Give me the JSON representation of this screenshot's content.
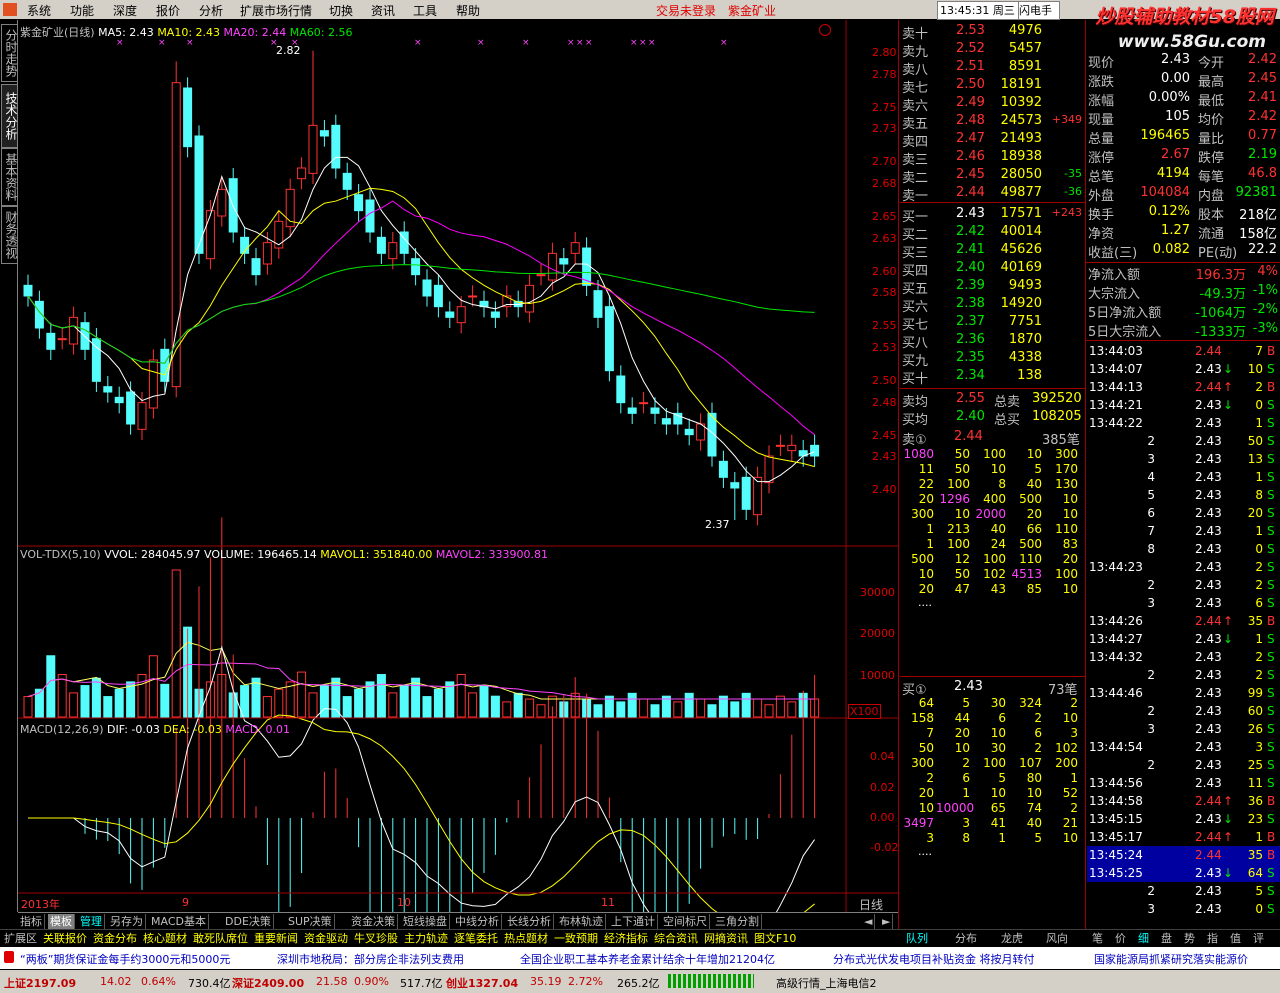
{
  "menubar": {
    "items": [
      "系统",
      "功能",
      "深度",
      "报价",
      "分析",
      "扩展市场行情",
      "切换",
      "资讯",
      "工具",
      "帮助"
    ],
    "status_text": "交易未登录",
    "stock_name": "紫金矿业",
    "clock": "13:45:31 周三",
    "flash": "闪电手",
    "watermark": "炒股辅助教材58股网",
    "watermark2": "www.58Gu.com"
  },
  "left_tabs": [
    "分时走势",
    "技术分析",
    "基本资料",
    "财务透视"
  ],
  "kline": {
    "title": "紫金矿业(日线)",
    "ma5": "MA5: 2.43",
    "ma10": "MA10: 2.43",
    "ma20": "MA20: 2.44",
    "ma60": "MA60: 2.56",
    "high_label": "2.82",
    "low_label": "2.37",
    "y_ticks": [
      "2.80",
      "2.78",
      "2.75",
      "2.73",
      "2.70",
      "2.68",
      "2.65",
      "2.63",
      "2.60",
      "2.58",
      "2.55",
      "2.53",
      "2.50",
      "2.48",
      "2.45",
      "2.43",
      "2.40"
    ],
    "x_labels": [
      "2013年",
      "9",
      "10",
      "11"
    ],
    "period": "日线"
  },
  "vol": {
    "title": "VOL-TDX(5,10)",
    "vvol": "VVOL: 284045.97",
    "volume": "VOLUME: 196465.14",
    "mavol1": "MAVOL1: 351840.00",
    "mavol2": "MAVOL2: 333900.81",
    "y_ticks": [
      "30000",
      "20000",
      "10000"
    ],
    "unit": "X100"
  },
  "macd": {
    "title": "MACD(12,26,9)",
    "dif": "DIF: -0.03",
    "dea": "DEA: -0.03",
    "macd": "MACD: 0.01",
    "y_ticks": [
      "0.04",
      "0.02",
      "0.00",
      "-0.02"
    ]
  },
  "orderbook": {
    "sells": [
      {
        "label": "卖十",
        "price": "2.53",
        "vol": "4976",
        "chg": ""
      },
      {
        "label": "卖九",
        "price": "2.52",
        "vol": "5457",
        "chg": ""
      },
      {
        "label": "卖八",
        "price": "2.51",
        "vol": "8591",
        "chg": ""
      },
      {
        "label": "卖七",
        "price": "2.50",
        "vol": "18191",
        "chg": ""
      },
      {
        "label": "卖六",
        "price": "2.49",
        "vol": "10392",
        "chg": ""
      },
      {
        "label": "卖五",
        "price": "2.48",
        "vol": "24573",
        "chg": "+349"
      },
      {
        "label": "卖四",
        "price": "2.47",
        "vol": "21493",
        "chg": ""
      },
      {
        "label": "卖三",
        "price": "2.46",
        "vol": "18938",
        "chg": ""
      },
      {
        "label": "卖二",
        "price": "2.45",
        "vol": "28050",
        "chg": "-35"
      },
      {
        "label": "卖一",
        "price": "2.44",
        "vol": "49877",
        "chg": "-36"
      }
    ],
    "buys": [
      {
        "label": "买一",
        "price": "2.43",
        "vol": "17571",
        "chg": "+243"
      },
      {
        "label": "买二",
        "price": "2.42",
        "vol": "40014",
        "chg": ""
      },
      {
        "label": "买三",
        "price": "2.41",
        "vol": "45626",
        "chg": ""
      },
      {
        "label": "买四",
        "price": "2.40",
        "vol": "40169",
        "chg": ""
      },
      {
        "label": "买五",
        "price": "2.39",
        "vol": "9493",
        "chg": ""
      },
      {
        "label": "买六",
        "price": "2.38",
        "vol": "14920",
        "chg": ""
      },
      {
        "label": "买七",
        "price": "2.37",
        "vol": "7751",
        "chg": ""
      },
      {
        "label": "买八",
        "price": "2.36",
        "vol": "1870",
        "chg": ""
      },
      {
        "label": "买九",
        "price": "2.35",
        "vol": "4338",
        "chg": ""
      },
      {
        "label": "买十",
        "price": "2.34",
        "vol": "138",
        "chg": ""
      }
    ],
    "avg_sell_label": "卖均",
    "avg_sell": "2.55",
    "total_sell_label": "总卖",
    "total_sell": "392520",
    "avg_buy_label": "买均",
    "avg_buy": "2.40",
    "total_buy_label": "总买",
    "total_buy": "108205",
    "sell1_queue_label": "卖①",
    "sell1_queue_price": "2.44",
    "sell1_queue_count": "385笔",
    "sell1_queue": [
      [
        "1080",
        "50",
        "100",
        "10",
        "300"
      ],
      [
        "11",
        "50",
        "10",
        "5",
        "170"
      ],
      [
        "22",
        "100",
        "8",
        "40",
        "130"
      ],
      [
        "20",
        "1296",
        "400",
        "500",
        "10"
      ],
      [
        "300",
        "10",
        "2000",
        "20",
        "10"
      ],
      [
        "1",
        "213",
        "40",
        "66",
        "110"
      ],
      [
        "1",
        "100",
        "24",
        "500",
        "83"
      ],
      [
        "500",
        "12",
        "100",
        "110",
        "20"
      ],
      [
        "10",
        "50",
        "102",
        "4513",
        "100"
      ],
      [
        "20",
        "47",
        "43",
        "85",
        "10"
      ]
    ],
    "more": "....",
    "buy1_queue_label": "买①",
    "buy1_queue_price": "2.43",
    "buy1_queue_count": "73笔",
    "buy1_queue": [
      [
        "64",
        "5",
        "30",
        "324",
        "2"
      ],
      [
        "158",
        "44",
        "6",
        "2",
        "10"
      ],
      [
        "7",
        "20",
        "10",
        "6",
        "3"
      ],
      [
        "50",
        "10",
        "30",
        "2",
        "102"
      ],
      [
        "300",
        "2",
        "100",
        "107",
        "200"
      ],
      [
        "2",
        "6",
        "5",
        "80",
        "1"
      ],
      [
        "20",
        "1",
        "10",
        "10",
        "52"
      ],
      [
        "10",
        "10000",
        "65",
        "74",
        "2"
      ],
      [
        "3497",
        "3",
        "41",
        "40",
        "21"
      ],
      [
        "3",
        "8",
        "1",
        "5",
        "10"
      ]
    ]
  },
  "stats": [
    {
      "k1": "现价",
      "v1": "2.43",
      "k2": "今开",
      "v2": "2.42"
    },
    {
      "k1": "涨跌",
      "v1": "0.00",
      "k2": "最高",
      "v2": "2.45"
    },
    {
      "k1": "涨幅",
      "v1": "0.00%",
      "k2": "最低",
      "v2": "2.41"
    },
    {
      "k1": "现量",
      "v1": "105",
      "k2": "均价",
      "v2": "2.42"
    },
    {
      "k1": "总量",
      "v1": "196465",
      "k2": "量比",
      "v2": "0.77"
    },
    {
      "k1": "涨停",
      "v1": "2.67",
      "k2": "跌停",
      "v2": "2.19"
    },
    {
      "k1": "总笔",
      "v1": "4194",
      "k2": "每笔",
      "v2": "46.8"
    },
    {
      "k1": "外盘",
      "v1": "104084",
      "k2": "内盘",
      "v2": "92381"
    },
    {
      "k1": "换手",
      "v1": "0.12%",
      "k2": "股本",
      "v2": "218亿"
    },
    {
      "k1": "净资",
      "v1": "1.27",
      "k2": "流通",
      "v2": "158亿"
    },
    {
      "k1": "收益(三)",
      "v1": "0.082",
      "k2": "PE(动)",
      "v2": "22.2"
    }
  ],
  "flows": [
    {
      "k": "净流入额",
      "v": "196.3万",
      "p": "4%"
    },
    {
      "k": "大宗流入",
      "v": "-49.3万",
      "p": "-1%"
    },
    {
      "k": "5日净流入额",
      "v": "-1064万",
      "p": "-2%"
    },
    {
      "k": "5日大宗流入",
      "v": "-1333万",
      "p": "-3%"
    }
  ],
  "ticks": [
    {
      "t": "13:44:03",
      "p": "2.44",
      "a": "",
      "v": "7",
      "d": "B"
    },
    {
      "t": "13:44:07",
      "p": "2.43",
      "a": "↓",
      "v": "10",
      "d": "S"
    },
    {
      "t": "13:44:13",
      "p": "2.44",
      "a": "↑",
      "v": "2",
      "d": "B"
    },
    {
      "t": "13:44:21",
      "p": "2.43",
      "a": "↓",
      "v": "0",
      "d": "S"
    },
    {
      "t": "13:44:22",
      "p": "2.43",
      "a": "",
      "v": "1",
      "d": "S"
    },
    {
      "t": "2",
      "p": "2.43",
      "a": "",
      "v": "50",
      "d": "S"
    },
    {
      "t": "3",
      "p": "2.43",
      "a": "",
      "v": "13",
      "d": "S"
    },
    {
      "t": "4",
      "p": "2.43",
      "a": "",
      "v": "1",
      "d": "S"
    },
    {
      "t": "5",
      "p": "2.43",
      "a": "",
      "v": "8",
      "d": "S"
    },
    {
      "t": "6",
      "p": "2.43",
      "a": "",
      "v": "20",
      "d": "S"
    },
    {
      "t": "7",
      "p": "2.43",
      "a": "",
      "v": "1",
      "d": "S"
    },
    {
      "t": "8",
      "p": "2.43",
      "a": "",
      "v": "0",
      "d": "S"
    },
    {
      "t": "13:44:23",
      "p": "2.43",
      "a": "",
      "v": "2",
      "d": "S"
    },
    {
      "t": "2",
      "p": "2.43",
      "a": "",
      "v": "2",
      "d": "S"
    },
    {
      "t": "3",
      "p": "2.43",
      "a": "",
      "v": "6",
      "d": "S"
    },
    {
      "t": "13:44:26",
      "p": "2.44",
      "a": "↑",
      "v": "35",
      "d": "B"
    },
    {
      "t": "13:44:27",
      "p": "2.43",
      "a": "↓",
      "v": "1",
      "d": "S"
    },
    {
      "t": "13:44:32",
      "p": "2.43",
      "a": "",
      "v": "2",
      "d": "S"
    },
    {
      "t": "2",
      "p": "2.43",
      "a": "",
      "v": "2",
      "d": "S"
    },
    {
      "t": "13:44:46",
      "p": "2.43",
      "a": "",
      "v": "99",
      "d": "S"
    },
    {
      "t": "2",
      "p": "2.43",
      "a": "",
      "v": "60",
      "d": "S"
    },
    {
      "t": "3",
      "p": "2.43",
      "a": "",
      "v": "26",
      "d": "S"
    },
    {
      "t": "13:44:54",
      "p": "2.43",
      "a": "",
      "v": "3",
      "d": "S"
    },
    {
      "t": "2",
      "p": "2.43",
      "a": "",
      "v": "25",
      "d": "S"
    },
    {
      "t": "13:44:56",
      "p": "2.43",
      "a": "",
      "v": "11",
      "d": "S"
    },
    {
      "t": "13:44:58",
      "p": "2.44",
      "a": "↑",
      "v": "36",
      "d": "B"
    },
    {
      "t": "13:45:15",
      "p": "2.43",
      "a": "↓",
      "v": "23",
      "d": "S"
    },
    {
      "t": "13:45:17",
      "p": "2.44",
      "a": "↑",
      "v": "1",
      "d": "B"
    },
    {
      "t": "13:45:24",
      "p": "2.44",
      "a": "",
      "v": "35",
      "d": "B"
    },
    {
      "t": "13:45:25",
      "p": "2.43",
      "a": "↓",
      "v": "64",
      "d": "S"
    },
    {
      "t": "2",
      "p": "2.43",
      "a": "",
      "v": "5",
      "d": "S"
    },
    {
      "t": "3",
      "p": "2.43",
      "a": "",
      "v": "0",
      "d": "S"
    }
  ],
  "bottom_tabs": [
    "指标",
    "模板",
    "管理",
    "另存为",
    "MACD基本",
    "DDE决策",
    "SUP决策",
    "资金决策",
    "短线操盘",
    "中线分析",
    "长线分析",
    "布林轨迹",
    "上下通计",
    "空间标尺",
    "三角分割"
  ],
  "bottom_right": [
    "◄",
    "►"
  ],
  "toolbar2": [
    "扩展区",
    "关联报价",
    "资金分布",
    "核心题材",
    "敢死队席位",
    "重要新闻",
    "资金驱动",
    "牛叉珍股",
    "主力轨迹",
    "逐笔委托",
    "热点题材",
    "一致预期",
    "经济指标",
    "综合资讯",
    "网摘资讯",
    "图文F10"
  ],
  "toolbar2_right": [
    "队列",
    "分布",
    "龙虎",
    "风向"
  ],
  "toolbar2_far": [
    "笔",
    "价",
    "细",
    "盘",
    "势",
    "指",
    "值",
    "评"
  ],
  "news": [
    "“两板”期货保证金每手约3000元和5000元",
    "深圳市地税局：部分房企非法列支费用",
    "全国企业职工基本养老金累计结余十年增加21204亿",
    "分布式光伏发电项目补贴资金 将按月转付",
    "国家能源局抓紧研究落实能源价"
  ],
  "statusbar": {
    "sh": "上证2197.09",
    "sh_chg": "14.02",
    "sh_pct": "0.64%",
    "sh_amt": "730.4亿",
    "sz": "深证2409.00",
    "sz_chg": "21.58",
    "sz_pct": "0.90%",
    "sz_amt": "517.7亿",
    "cy": "创业1327.04",
    "cy_chg": "35.19",
    "cy_pct": "2.72%",
    "cy_amt": "265.2亿",
    "conn": "高级行情_上海电信2"
  },
  "colors": {
    "up": "#ff3232",
    "down": "#54fcfc",
    "ma5": "#ffffff",
    "ma10": "#ffff00",
    "ma20": "#ff00ff",
    "ma60": "#00e600"
  }
}
